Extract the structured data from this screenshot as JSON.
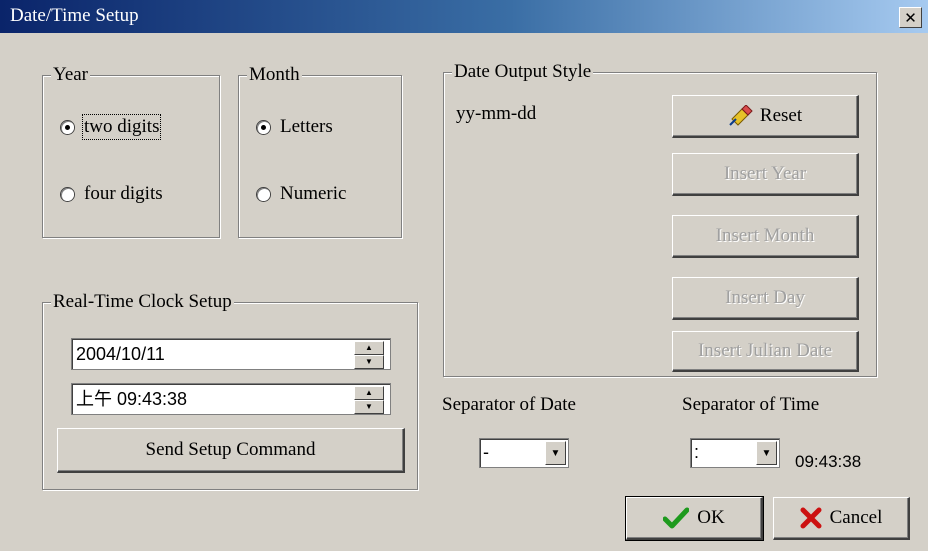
{
  "window": {
    "title": "Date/Time Setup",
    "close_glyph": "✕"
  },
  "year": {
    "legend": "Year",
    "options": [
      {
        "label": "two digits",
        "selected": true
      },
      {
        "label": "four digits",
        "selected": false
      }
    ]
  },
  "month": {
    "legend": "Month",
    "options": [
      {
        "label": "Letters",
        "selected": true
      },
      {
        "label": "Numeric",
        "selected": false
      }
    ]
  },
  "rtc": {
    "legend": "Real-Time Clock Setup",
    "date_value": "2004/10/11",
    "time_value": "上午 09:43:38",
    "send_label": "Send Setup Command"
  },
  "output": {
    "legend": "Date Output Style",
    "format_text": "yy-mm-dd",
    "reset_label": "Reset",
    "reset_icon": "eraser-icon",
    "insert_year_label": "Insert Year",
    "insert_month_label": "Insert Month",
    "insert_day_label": "Insert Day",
    "insert_julian_label": "Insert Julian Date"
  },
  "separators": {
    "date_label": "Separator of Date",
    "date_value": "-",
    "time_label": "Separator of Time",
    "time_value": ":",
    "time_preview": "09:43:38"
  },
  "footer": {
    "ok_label": "OK",
    "ok_icon": "checkmark-icon",
    "cancel_label": "Cancel",
    "cancel_icon": "x-icon"
  },
  "colors": {
    "titlebar_start": "#0a246a",
    "titlebar_end": "#a6caf0",
    "face": "#d4d0c8",
    "ok_green": "#1e9a1e",
    "cancel_red": "#cc1111"
  }
}
